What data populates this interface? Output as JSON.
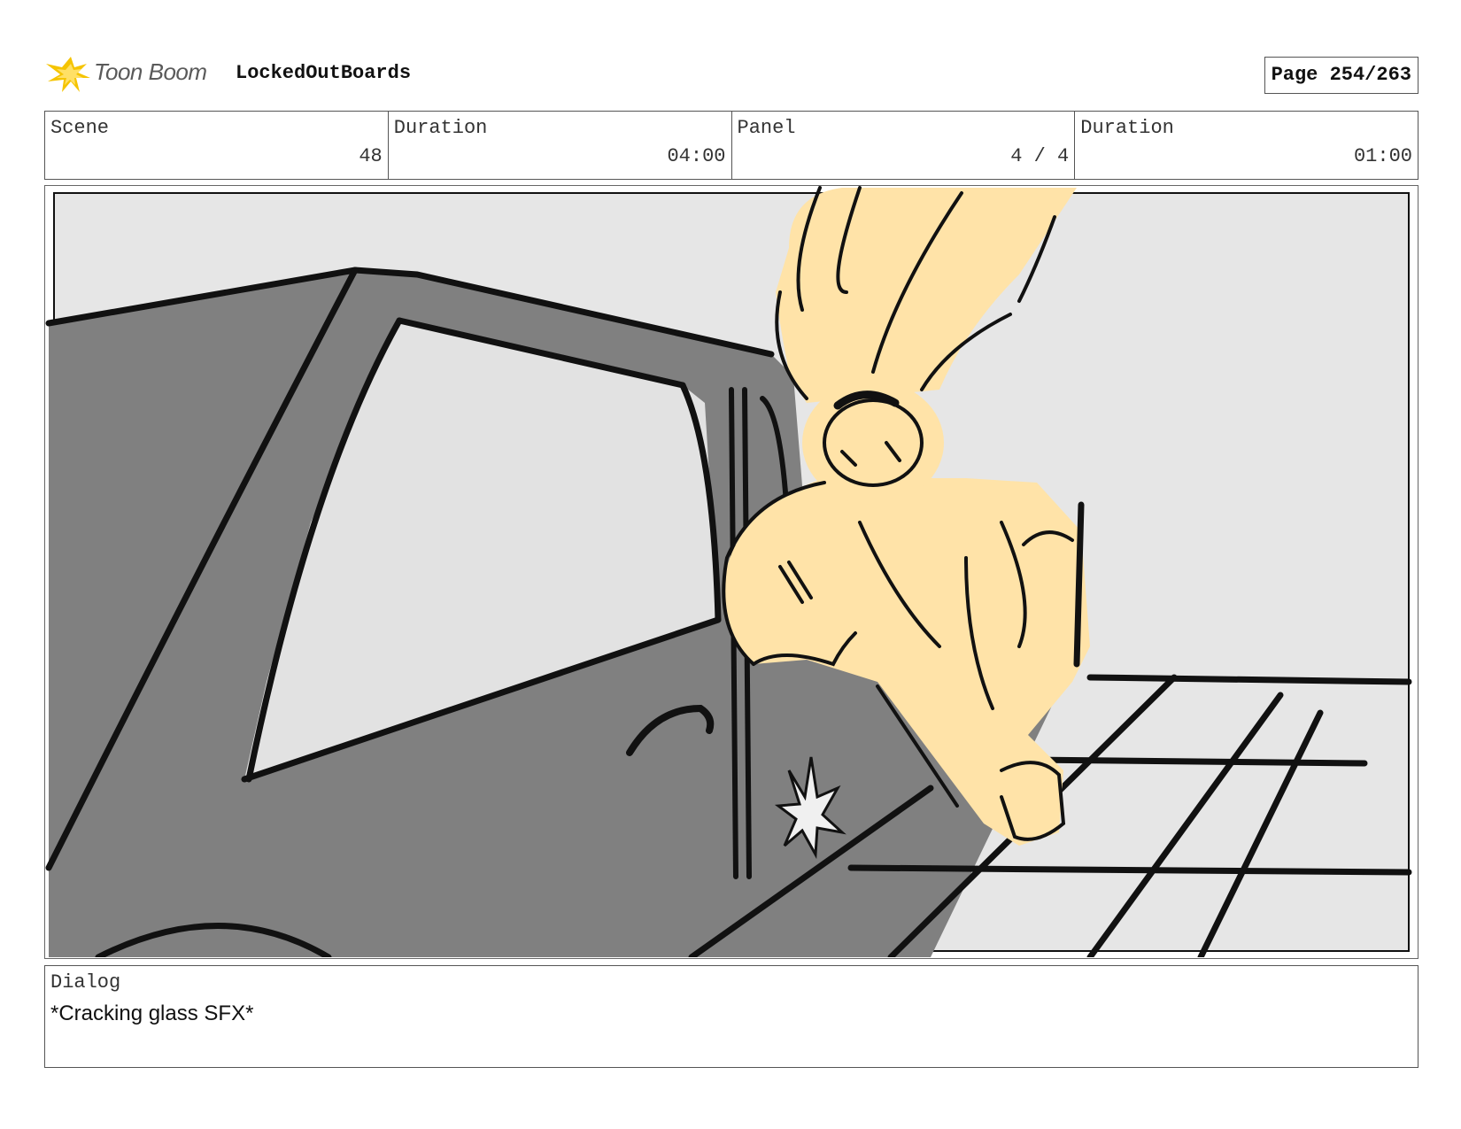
{
  "header": {
    "logo_text": "Toon Boom",
    "logo_icon": "starburst-icon",
    "project_title": "LockedOutBoards",
    "page_label": "Page 254/263"
  },
  "info": {
    "scene_label": "Scene",
    "scene_value": "48",
    "scene_duration_label": "Duration",
    "scene_duration_value": "04:00",
    "panel_label": "Panel",
    "panel_value": "4 / 4",
    "panel_duration_label": "Duration",
    "panel_duration_value": "01:00"
  },
  "panel": {
    "image": "storyboard-sketch-character-breaking-car-window",
    "colors": {
      "car": "#808080",
      "sky": "#e6e6e6",
      "figure": "#ffe3a8",
      "line": "#111111"
    }
  },
  "dialog": {
    "label": "Dialog",
    "text": "*Cracking glass SFX*"
  }
}
